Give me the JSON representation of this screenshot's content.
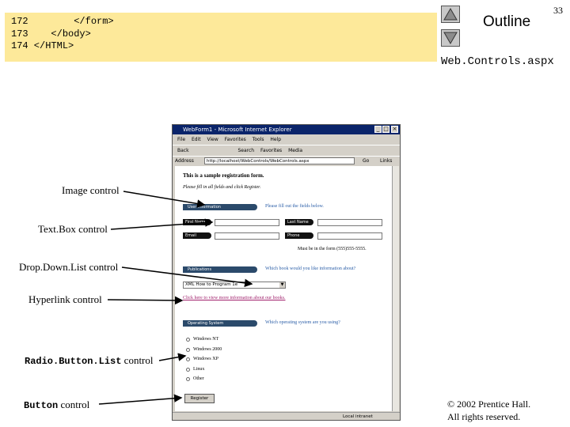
{
  "code": [
    {
      "num": "172",
      "text": "        </form>"
    },
    {
      "num": "173",
      "text": "    </body>"
    },
    {
      "num": "174",
      "text": " </HTML>"
    }
  ],
  "nav": {
    "outline": "Outline",
    "page_number": "33",
    "filename": "Web.Controls.aspx"
  },
  "labels": {
    "image": "Image control",
    "textbox": "Text.Box control",
    "dropdown": "Drop.Down.List control",
    "hyperlink": "Hyperlink control",
    "radio_mono": "Radio.Button.List",
    "radio_rest": " control",
    "button_mono": "Button",
    "button_rest": " control"
  },
  "browser": {
    "title": "WebForm1 - Microsoft Internet Explorer",
    "menu": [
      "File",
      "Edit",
      "View",
      "Favorites",
      "Tools",
      "Help"
    ],
    "toolbar": [
      "Back",
      "Search",
      "Favorites",
      "Media"
    ],
    "address_label": "Address",
    "address": "http://localhost/WebControls/WebControls.aspx",
    "go": "Go",
    "links": "Links",
    "status": "Local intranet"
  },
  "form": {
    "heading": "This is a sample registration form.",
    "instructions": "Please fill in all fields and click Register.",
    "user_info_pill": "User Information",
    "user_info_prompt": "Please fill out the fields below.",
    "first_name": "First Name",
    "last_name": "Last Name",
    "email": "Email",
    "phone": "Phone",
    "phone_hint": "Must be in the form (555)555-5555.",
    "publications_pill": "Publications",
    "publications_prompt": "Which book would you like information about?",
    "dropdown_value": "XML How to Program 1e",
    "hyperlink": "Click here to view more information about our books.",
    "os_pill": "Operating System",
    "os_prompt": "Which operating system are you using?",
    "os_options": [
      "Windows NT",
      "Windows 2000",
      "Windows XP",
      "Linux",
      "Other"
    ],
    "register_button": "Register"
  },
  "copyright": {
    "line1": "© 2002 Prentice Hall.",
    "line2": "All rights reserved."
  }
}
